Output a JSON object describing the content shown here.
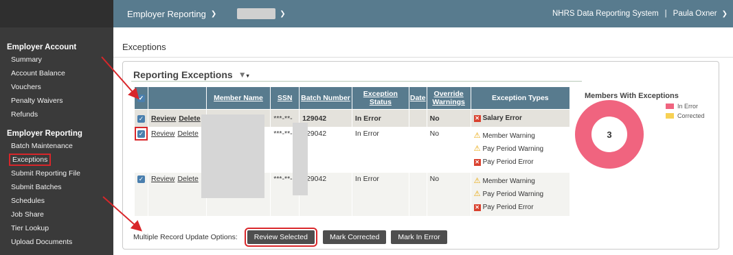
{
  "topbar": {
    "section_label": "Employer Reporting",
    "system_name": "NHRS Data Reporting System",
    "separator": "|",
    "user_name": "Paula Oxner"
  },
  "sidebar": {
    "employer_account": {
      "heading": "Employer Account",
      "items": [
        "Summary",
        "Account Balance",
        "Vouchers",
        "Penalty Waivers",
        "Refunds"
      ]
    },
    "employer_reporting": {
      "heading": "Employer Reporting",
      "items": [
        "Batch Maintenance",
        "Exceptions",
        "Submit Reporting File",
        "Submit Batches",
        "Schedules",
        "Job Share",
        "Tier Lookup",
        "Upload Documents"
      ]
    }
  },
  "page": {
    "title": "Exceptions",
    "panel_title": "Reporting Exceptions"
  },
  "table": {
    "headers": [
      "Member Name",
      "SSN",
      "Batch Number",
      "Exception Status",
      "Date",
      "Override Warnings",
      "Exception Types"
    ],
    "rows": [
      {
        "review": "Review",
        "delete": "Delete",
        "ssn": "***-**-",
        "batch": "129042",
        "status": "In Error",
        "date": "",
        "override": "No",
        "types": [
          {
            "kind": "error",
            "label": "Salary Error"
          }
        ]
      },
      {
        "review": "Review",
        "delete": "Delete",
        "ssn": "***-**-(",
        "batch": "129042",
        "status": "In Error",
        "date": "",
        "override": "No",
        "types": [
          {
            "kind": "warning",
            "label": "Member Warning"
          },
          {
            "kind": "warning",
            "label": "Pay Period Warning"
          },
          {
            "kind": "error",
            "label": "Pay Period Error"
          }
        ]
      },
      {
        "review": "Review",
        "delete": "Delete",
        "ssn": "***-**-:",
        "batch": "129042",
        "status": "In Error",
        "date": "",
        "override": "No",
        "types": [
          {
            "kind": "warning",
            "label": "Member Warning"
          },
          {
            "kind": "warning",
            "label": "Pay Period Warning"
          },
          {
            "kind": "error",
            "label": "Pay Period Error"
          }
        ]
      }
    ]
  },
  "chart": {
    "title": "Members With Exceptions",
    "center_value": "3",
    "legend": [
      {
        "label": "In Error",
        "color": "#f0647f"
      },
      {
        "label": "Corrected",
        "color": "#f7d154"
      }
    ],
    "ring_color": "#f0647f"
  },
  "bulk": {
    "label": "Multiple Record Update Options:",
    "buttons": [
      "Review Selected",
      "Mark Corrected",
      "Mark In Error"
    ]
  },
  "colors": {
    "accent": "#587b8e",
    "highlight": "#d9262a"
  }
}
